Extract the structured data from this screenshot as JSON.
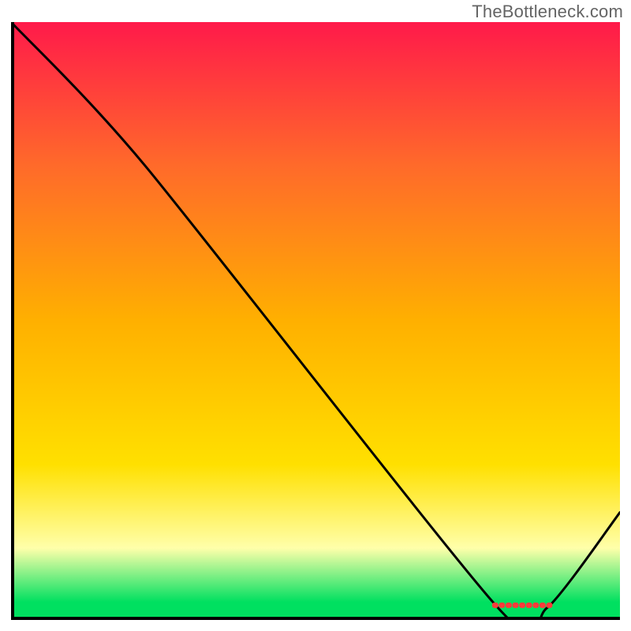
{
  "attribution": "TheBottleneck.com",
  "colors": {
    "gradient_top": "#ff1a4a",
    "gradient_mid_upper": "#ff6a2a",
    "gradient_mid": "#ffb000",
    "gradient_mid_lower": "#ffe000",
    "gradient_low": "#ffffaa",
    "gradient_bottom": "#00e060",
    "axis": "#000000",
    "curve": "#000000",
    "optimal_marker": "#ff3a3a"
  },
  "chart_data": {
    "type": "line",
    "title": "",
    "xlabel": "",
    "ylabel": "",
    "xlim": [
      0,
      100
    ],
    "ylim": [
      0,
      100
    ],
    "x": [
      0,
      22,
      80,
      88,
      100
    ],
    "values": [
      100,
      76,
      2,
      2,
      18
    ],
    "optimal_range": {
      "start": 79,
      "end": 89,
      "level": 2
    },
    "gradient_stops": [
      {
        "offset": 0,
        "color_key": "gradient_top"
      },
      {
        "offset": 24,
        "color_key": "gradient_mid_upper"
      },
      {
        "offset": 50,
        "color_key": "gradient_mid"
      },
      {
        "offset": 74,
        "color_key": "gradient_mid_lower"
      },
      {
        "offset": 88,
        "color_key": "gradient_low"
      },
      {
        "offset": 97,
        "color_key": "gradient_bottom"
      },
      {
        "offset": 100,
        "color_key": "gradient_bottom"
      }
    ]
  }
}
